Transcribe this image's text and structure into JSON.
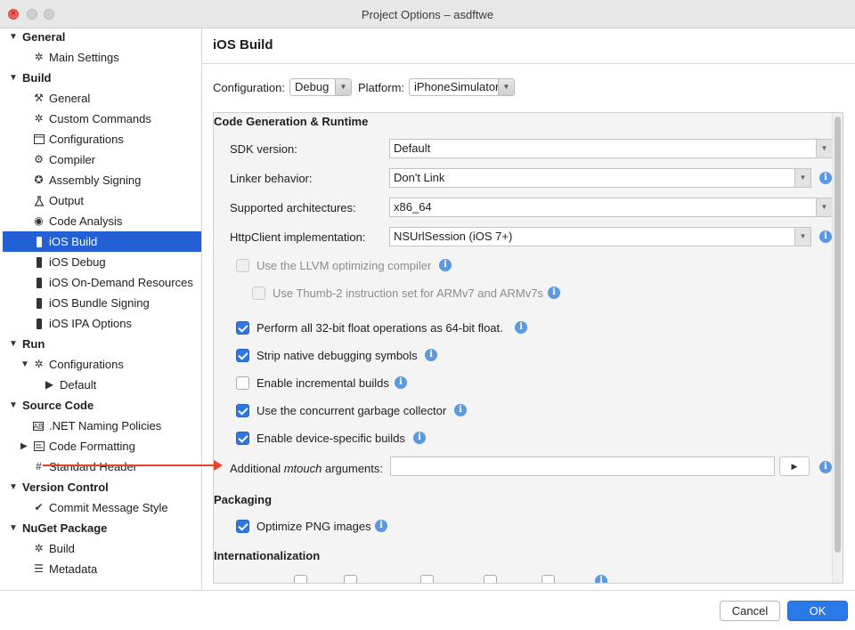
{
  "window": {
    "title": "Project Options – asdftwe"
  },
  "colors": {
    "accent": "#2360d5",
    "ok_button": "#2a79e8",
    "annotation_arrow": "#e5442a",
    "info_icon": "#5b9ade"
  },
  "sidebar": {
    "items": [
      {
        "label": "General",
        "type": "header",
        "expanded": true
      },
      {
        "label": "Main Settings",
        "icon": "gear-icon"
      },
      {
        "label": "Build",
        "type": "header",
        "expanded": true
      },
      {
        "label": "General",
        "icon": "hammer-icon"
      },
      {
        "label": "Custom Commands",
        "icon": "gear-icon"
      },
      {
        "label": "Configurations",
        "icon": "window-icon"
      },
      {
        "label": "Compiler",
        "icon": "cog-eye-icon"
      },
      {
        "label": "Assembly Signing",
        "icon": "certificate-icon"
      },
      {
        "label": "Output",
        "icon": "flask-icon"
      },
      {
        "label": "Code Analysis",
        "icon": "target-icon"
      },
      {
        "label": "iOS Build",
        "icon": "phone-icon",
        "selected": true
      },
      {
        "label": "iOS Debug",
        "icon": "phone-icon"
      },
      {
        "label": "iOS On-Demand Resources",
        "icon": "phone-icon"
      },
      {
        "label": "iOS Bundle Signing",
        "icon": "phone-icon"
      },
      {
        "label": "iOS IPA Options",
        "icon": "phone-icon"
      },
      {
        "label": "Run",
        "type": "header",
        "expanded": true
      },
      {
        "label": "Configurations",
        "icon": "gear-icon",
        "expanded": true
      },
      {
        "label": "Default",
        "icon": "play-icon"
      },
      {
        "label": "Source Code",
        "type": "header",
        "expanded": true
      },
      {
        "label": ".NET Naming Policies",
        "icon": "naming-icon"
      },
      {
        "label": "Code Formatting",
        "icon": "format-icon",
        "collapsed": true
      },
      {
        "label": "Standard Header",
        "icon": "header-icon"
      },
      {
        "label": "Version Control",
        "type": "header",
        "expanded": true
      },
      {
        "label": "Commit Message Style",
        "icon": "check-circle-icon"
      },
      {
        "label": "NuGet Package",
        "type": "header",
        "expanded": true
      },
      {
        "label": "Build",
        "icon": "gear-icon"
      },
      {
        "label": "Metadata",
        "icon": "list-icon"
      }
    ]
  },
  "main": {
    "title": "iOS Build",
    "configuration_label": "Configuration:",
    "configuration_value": "Debug",
    "platform_label": "Platform:",
    "platform_value": "iPhoneSimulator",
    "code_gen": {
      "section_title": "Code Generation & Runtime",
      "sdk_label": "SDK version:",
      "sdk_value": "Default",
      "linker_label": "Linker behavior:",
      "linker_value": "Don't Link",
      "arch_label": "Supported architectures:",
      "arch_value": "x86_64",
      "http_label": "HttpClient implementation:",
      "http_value": "NSUrlSession (iOS 7+)",
      "llvm_label": "Use the LLVM optimizing compiler",
      "thumb_label": "Use Thumb-2 instruction set for ARMv7 and ARMv7s",
      "float_label": "Perform all 32-bit float operations as 64-bit float.",
      "strip_label": "Strip native debugging symbols",
      "incremental_label": "Enable incremental builds",
      "gc_label": "Use the concurrent garbage collector",
      "device_label": "Enable device-specific builds",
      "mtouch_label_pre": "Additional ",
      "mtouch_label_em": "mtouch",
      "mtouch_label_post": " arguments:",
      "mtouch_value": ""
    },
    "packaging": {
      "section_title": "Packaging",
      "png_label": "Optimize PNG images"
    },
    "i18n": {
      "section_title": "Internationalization"
    }
  },
  "footer": {
    "cancel_label": "Cancel",
    "ok_label": "OK"
  }
}
